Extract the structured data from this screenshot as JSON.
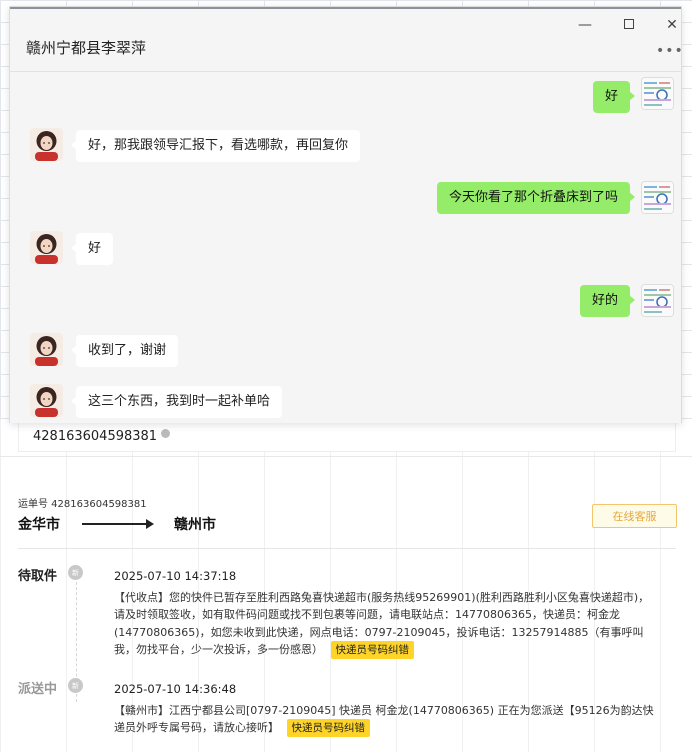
{
  "chat": {
    "title": "赣州宁都县李翠萍",
    "window_controls": {
      "minimize": "—",
      "close": "✕",
      "more": "•••"
    },
    "messages": [
      {
        "side": "right",
        "text": "好"
      },
      {
        "side": "left",
        "text": "好，那我跟领导汇报下，看选哪款，再回复你"
      },
      {
        "side": "right",
        "text": "今天你看了那个折叠床到了吗"
      },
      {
        "side": "left",
        "text": "好"
      },
      {
        "side": "right",
        "text": "好的"
      },
      {
        "side": "left",
        "text": "收到了，谢谢"
      },
      {
        "side": "left",
        "text": "这三个东西，我到时一起补单哈"
      }
    ]
  },
  "tracking": {
    "search_number": "428163604598381",
    "waybill_label": "运单号 428163604598381",
    "origin": "金华市",
    "destination": "赣州市",
    "service_button": "在线客服",
    "events": [
      {
        "status": "待取件",
        "badge": "新",
        "time": "2025-07-10 14:37:18",
        "text": "【代收点】您的快件已暂存至胜利西路兔喜快递超市(服务热线95269901)(胜利西路胜利小区兔喜快递超市)，请及时领取签收，如有取件码问题或找不到包裹等问题，请电联站点：14770806365，快递员：柯金龙(14770806365)，如您未收到此快递，网点电话：0797-2109045，投诉电话：13257914885（有事呼叫我，勿找平台，少一次投诉，多一份感恩）",
        "button": "快递员号码纠错"
      },
      {
        "status": "派送中",
        "badge": "新",
        "time": "2025-07-10 14:36:48",
        "text": "【赣州市】江西宁都县公司[0797-2109045] 快递员 柯金龙(14770806365) 正在为您派送【95126为韵达快递员外呼专属号码，请放心接听】",
        "button": "快递员号码纠错"
      }
    ]
  },
  "colors": {
    "bubble_green": "#95ec69",
    "fix_button": "#ffd428",
    "service_border": "#f5c56b"
  }
}
